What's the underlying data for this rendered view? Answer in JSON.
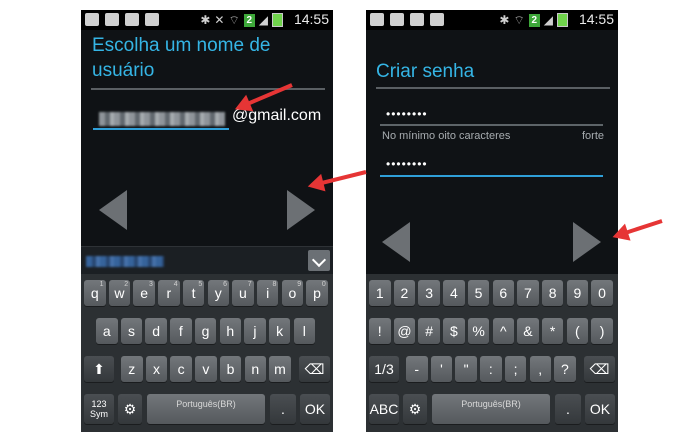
{
  "status_bar": {
    "time": "14:55",
    "notification_badge": "2"
  },
  "left_screen": {
    "title_line1": "Escolha um nome de",
    "title_line2": "usuário",
    "email_suffix": "@gmail.com",
    "keyboard": {
      "row1": [
        "q",
        "w",
        "e",
        "r",
        "t",
        "y",
        "u",
        "i",
        "o",
        "p"
      ],
      "row1_sup": [
        "1",
        "2",
        "3",
        "4",
        "5",
        "6",
        "7",
        "8",
        "9",
        "0"
      ],
      "row2": [
        "a",
        "s",
        "d",
        "f",
        "g",
        "h",
        "j",
        "k",
        "l"
      ],
      "row3": [
        "z",
        "x",
        "c",
        "v",
        "b",
        "n",
        "m"
      ],
      "shift_icon": "shift-arrow-up",
      "backspace_icon": "backspace",
      "sym_label_top": "123",
      "sym_label_bottom": "Sym",
      "settings_icon": "gear",
      "space_label": "Português(BR)",
      "period_label": ".",
      "ok_label": "OK"
    }
  },
  "right_screen": {
    "title": "Criar senha",
    "password_value": "••••••••",
    "confirm_value": "••••••••",
    "helper_text": "No mínimo oito caracteres",
    "strength_text": "forte",
    "keyboard": {
      "row1": [
        "1",
        "2",
        "3",
        "4",
        "5",
        "6",
        "7",
        "8",
        "9",
        "0"
      ],
      "row2": [
        "!",
        "@",
        "#",
        "$",
        "%",
        "^",
        "&",
        "*",
        "(",
        ")"
      ],
      "row3_label": "1/3",
      "row3": [
        "-",
        "'",
        "\"",
        ":",
        ";",
        ",",
        "?"
      ],
      "backspace_icon": "backspace",
      "abc_label": "ABC",
      "settings_icon": "gear",
      "space_label": "Português(BR)",
      "period_label": ".",
      "ok_label": "OK"
    }
  },
  "colors": {
    "accent": "#35b5e5",
    "annotation_arrow": "#e63535",
    "field_underline": "#2f9fd8"
  }
}
